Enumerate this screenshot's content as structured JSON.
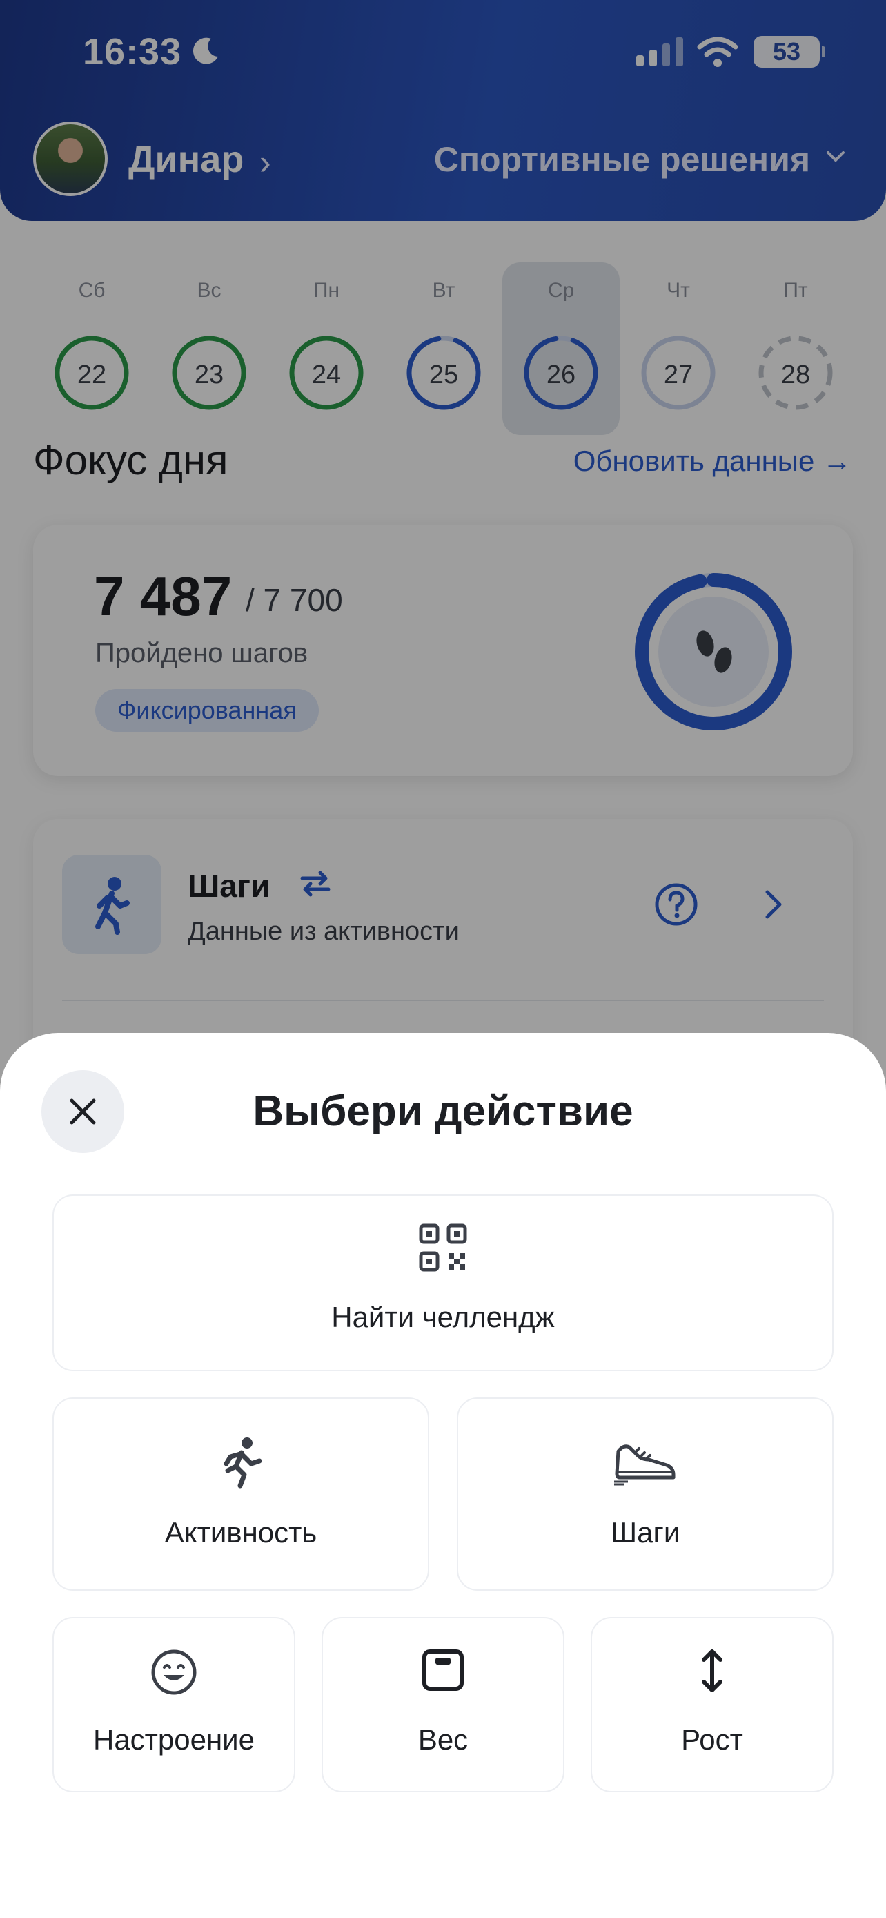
{
  "status_bar": {
    "time": "16:33",
    "battery": "53"
  },
  "header": {
    "user_name": "Динар",
    "organization": "Спортивные решения"
  },
  "week": [
    {
      "day": "Сб",
      "date": "22",
      "state": "done"
    },
    {
      "day": "Вс",
      "date": "23",
      "state": "done"
    },
    {
      "day": "Пн",
      "date": "24",
      "state": "done"
    },
    {
      "day": "Вт",
      "date": "25",
      "state": "partial"
    },
    {
      "day": "Ср",
      "date": "26",
      "state": "partial-selected"
    },
    {
      "day": "Чт",
      "date": "27",
      "state": "future"
    },
    {
      "day": "Пт",
      "date": "28",
      "state": "empty"
    }
  ],
  "focus": {
    "title": "Фокус дня",
    "refresh_link": "Обновить данные →",
    "steps_value": "7 487",
    "steps_goal": "/ 7 700",
    "steps_label": "Пройдено шагов",
    "goal_tag": "Фиксированная",
    "progress_fraction": 0.97
  },
  "steps_row": {
    "title": "Шаги",
    "subtitle": "Данные из активности"
  },
  "sheet": {
    "title": "Выбери действие",
    "actions": [
      {
        "label": "Найти челлендж",
        "icon": "qr-code-icon"
      },
      {
        "label": "Активность",
        "icon": "running-icon"
      },
      {
        "label": "Шаги",
        "icon": "sneaker-icon"
      },
      {
        "label": "Настроение",
        "icon": "smile-icon"
      },
      {
        "label": "Вес",
        "icon": "scale-icon"
      },
      {
        "label": "Рост",
        "icon": "height-arrow-icon"
      }
    ]
  },
  "colors": {
    "accent": "#2d5ccf",
    "done": "#2a9a4a",
    "header": "#2a4fb0"
  }
}
